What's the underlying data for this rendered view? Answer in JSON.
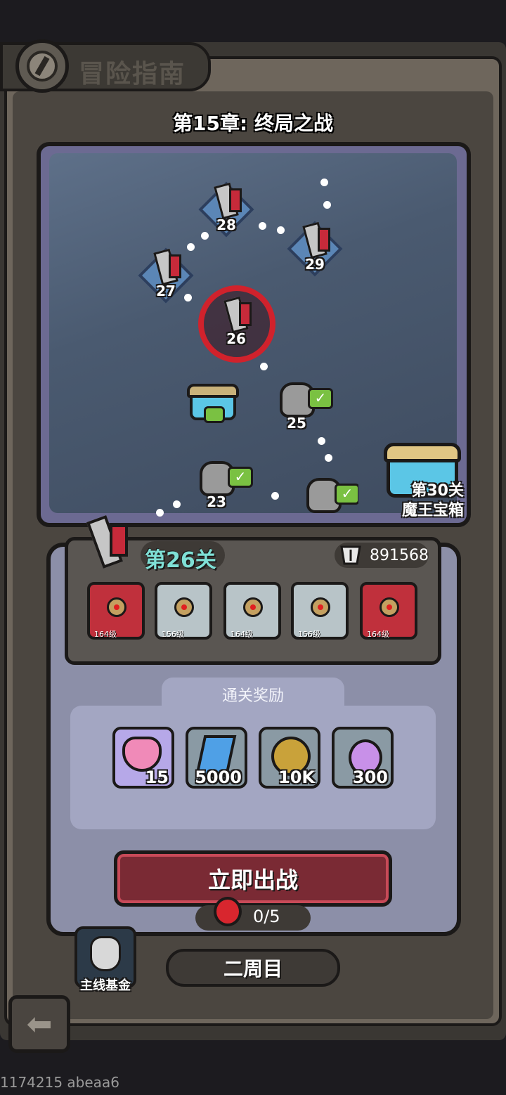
{
  "header": {
    "title": "冒险指南"
  },
  "chapter": {
    "title": "第15章: 终局之战"
  },
  "map": {
    "nodes": [
      {
        "label": "28",
        "state": "locked"
      },
      {
        "label": "29",
        "state": "locked"
      },
      {
        "label": "27",
        "state": "locked"
      },
      {
        "label": "26",
        "state": "current"
      },
      {
        "label": "25",
        "state": "cleared"
      },
      {
        "label": "23",
        "state": "cleared"
      }
    ],
    "big_chest": {
      "line1": "第30关",
      "line2": "魔王宝箱"
    }
  },
  "stage": {
    "label": "第26关",
    "power": "891568",
    "heroes": [
      {
        "level": "164级",
        "color": "red"
      },
      {
        "level": "156级",
        "color": "grey"
      },
      {
        "level": "164级",
        "color": "grey"
      },
      {
        "level": "156级",
        "color": "grey"
      },
      {
        "level": "164级",
        "color": "red"
      }
    ]
  },
  "rewards": {
    "title": "通关奖励",
    "items": [
      {
        "icon": "heart-icon",
        "count": "15"
      },
      {
        "icon": "crystal-icon",
        "count": "5000"
      },
      {
        "icon": "coin-icon",
        "count": "10K"
      },
      {
        "icon": "potion-icon",
        "count": "300"
      }
    ]
  },
  "actions": {
    "fight_label": "立即出战",
    "stamina": "0/5",
    "fund_label": "主线基金",
    "second_round_label": "二周目"
  },
  "footer": {
    "id": "1174215 abeaa6"
  },
  "colors": {
    "accent_red": "#d0222c",
    "stage_text": "#7fe0d6",
    "check_green": "#7ac142"
  }
}
